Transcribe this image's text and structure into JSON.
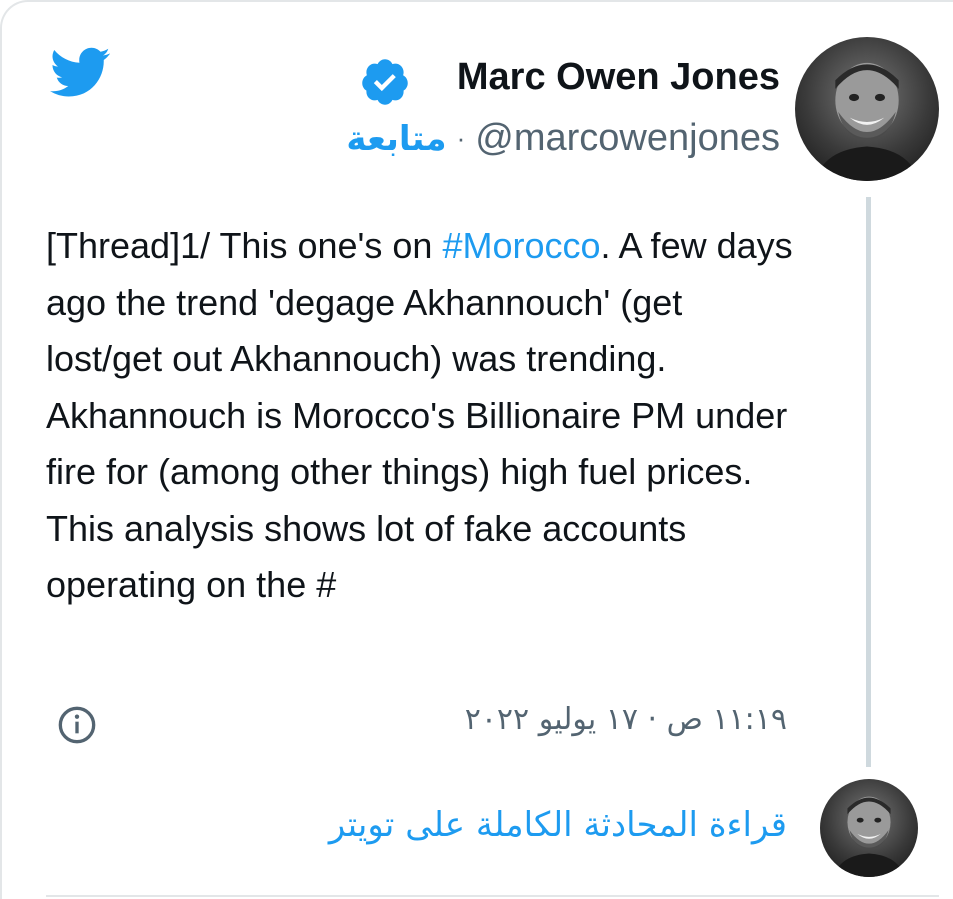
{
  "tweet": {
    "author_name": "Marc Owen Jones",
    "handle": "@marcowenjones",
    "separator": "·",
    "follow_label": "متابعة",
    "text_parts": {
      "before": "[Thread]1/ This one's on ",
      "hashtag": "#Morocco",
      "after": ". A few days ago the trend 'degage Akhannouch' (get lost/get out Akhannouch) was trending. Akhannouch is Morocco's Billionaire PM under fire for (among other things) high fuel prices. This analysis shows lot of fake accounts operating on the #"
    },
    "timestamp": "١١:١٩ ص · ١٧ يوليو ٢٠٢٢"
  },
  "footer": {
    "read_conversation_label": "قراءة المحادثة الكاملة على تويتر"
  },
  "icons": {
    "logo": "twitter-bird-icon",
    "verified": "verified-badge-icon",
    "info": "info-icon"
  },
  "colors": {
    "twitter_blue": "#1d9bf0",
    "text_primary": "#0f1419",
    "text_secondary": "#536471",
    "thread_line": "#cfd9de"
  }
}
